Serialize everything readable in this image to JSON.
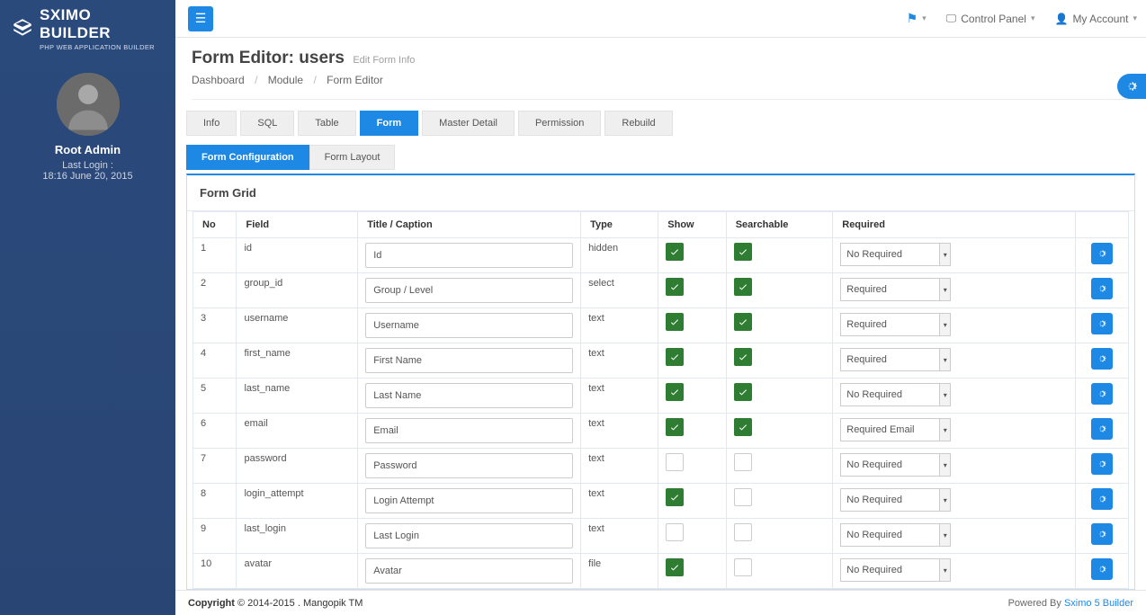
{
  "brand": {
    "title": "SXIMO BUILDER",
    "subtitle": "PHP WEB APPLICATION BUILDER"
  },
  "user": {
    "name": "Root Admin",
    "last_login_lbl": "Last Login :",
    "last_login": "18:16 June 20, 2015"
  },
  "topbar": {
    "control_panel": "Control Panel",
    "my_account": "My Account"
  },
  "page": {
    "title": "Form Editor: users",
    "subtitle": "Edit Form Info"
  },
  "breadcrumb": {
    "a": "Dashboard",
    "b": "Module",
    "c": "Form Editor"
  },
  "tabs1": [
    {
      "label": "Info",
      "active": false
    },
    {
      "label": "SQL",
      "active": false
    },
    {
      "label": "Table",
      "active": false
    },
    {
      "label": "Form",
      "active": true
    },
    {
      "label": "Master Detail",
      "active": false
    },
    {
      "label": "Permission",
      "active": false
    },
    {
      "label": "Rebuild",
      "active": false
    }
  ],
  "tabs2": [
    {
      "label": "Form Configuration",
      "active": true
    },
    {
      "label": "Form Layout",
      "active": false
    }
  ],
  "panel_title": "Form Grid",
  "columns": {
    "no": "No",
    "field": "Field",
    "title": "Title / Caption",
    "type": "Type",
    "show": "Show",
    "search": "Searchable",
    "required": "Required"
  },
  "rows": [
    {
      "no": "1",
      "field": "id",
      "title": "Id",
      "type": "hidden",
      "show": true,
      "search": true,
      "required": "No Required"
    },
    {
      "no": "2",
      "field": "group_id",
      "title": "Group / Level",
      "type": "select",
      "show": true,
      "search": true,
      "required": "Required"
    },
    {
      "no": "3",
      "field": "username",
      "title": "Username",
      "type": "text",
      "show": true,
      "search": true,
      "required": "Required"
    },
    {
      "no": "4",
      "field": "first_name",
      "title": "First Name",
      "type": "text",
      "show": true,
      "search": true,
      "required": "Required"
    },
    {
      "no": "5",
      "field": "last_name",
      "title": "Last Name",
      "type": "text",
      "show": true,
      "search": true,
      "required": "No Required"
    },
    {
      "no": "6",
      "field": "email",
      "title": "Email",
      "type": "text",
      "show": true,
      "search": true,
      "required": "Required Email"
    },
    {
      "no": "7",
      "field": "password",
      "title": "Password",
      "type": "text",
      "show": false,
      "search": false,
      "required": "No Required"
    },
    {
      "no": "8",
      "field": "login_attempt",
      "title": "Login Attempt",
      "type": "text",
      "show": true,
      "search": false,
      "required": "No Required"
    },
    {
      "no": "9",
      "field": "last_login",
      "title": "Last Login",
      "type": "text",
      "show": false,
      "search": false,
      "required": "No Required"
    },
    {
      "no": "10",
      "field": "avatar",
      "title": "Avatar",
      "type": "file",
      "show": true,
      "search": false,
      "required": "No Required"
    }
  ],
  "footer": {
    "copyright_bold": "Copyright",
    "copyright_rest": " © 2014-2015 . Mangopik TM",
    "powered": "Powered By ",
    "powered_link": "Sximo 5 Builder"
  }
}
